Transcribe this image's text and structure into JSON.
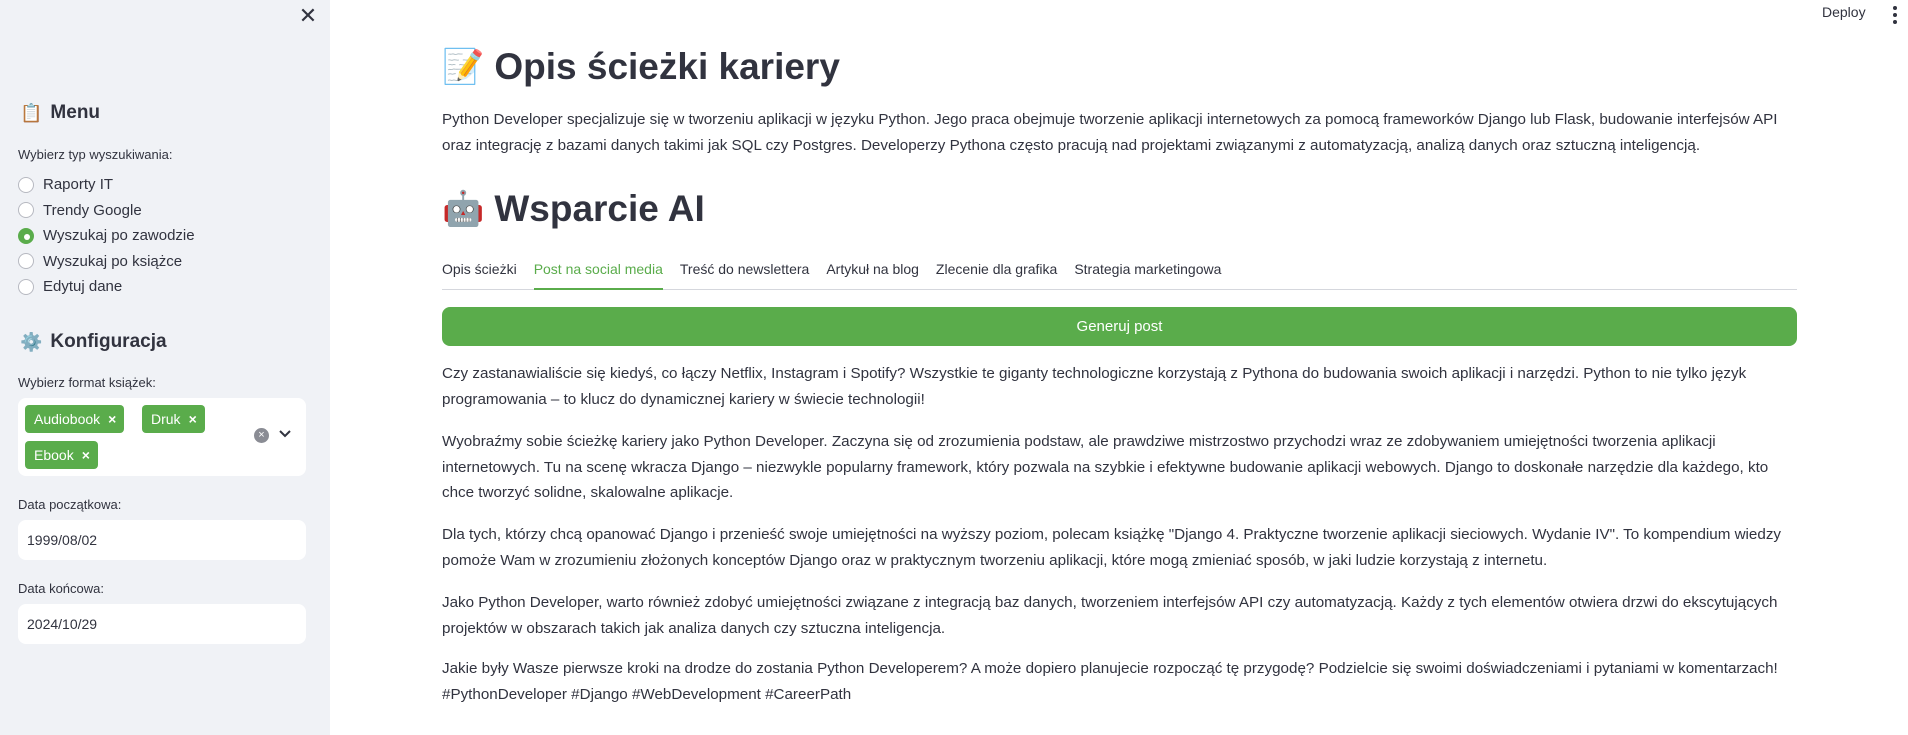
{
  "sidebar": {
    "menu": {
      "icon": "📋",
      "title": "Menu"
    },
    "search_type": {
      "label": "Wybierz typ wyszukiwania:",
      "options": [
        "Raporty IT",
        "Trendy Google",
        "Wyszukaj po zawodzie",
        "Wyszukaj po książce",
        "Edytuj dane"
      ],
      "selected": "Wyszukaj po zawodzie"
    },
    "config": {
      "icon": "⚙️",
      "title": "Konfiguracja"
    },
    "book_format": {
      "label": "Wybierz format książek:",
      "tags": [
        "Audiobook",
        "Druk",
        "Ebook"
      ],
      "tag_remove": "×",
      "clear": "×"
    },
    "start_date": {
      "label": "Data początkowa:",
      "value": "1999/08/02"
    },
    "end_date": {
      "label": "Data końcowa:",
      "value": "2024/10/29"
    },
    "close": "✕"
  },
  "header": {
    "deploy": "Deploy"
  },
  "main": {
    "career": {
      "icon": "📝",
      "title": "Opis ścieżki kariery",
      "text": "Python Developer specjalizuje się w tworzeniu aplikacji w języku Python. Jego praca obejmuje tworzenie aplikacji internetowych za pomocą frameworków Django lub Flask, budowanie interfejsów API oraz integrację z bazami danych takimi jak SQL czy Postgres. Developerzy Pythona często pracują nad projektami związanymi z automatyzacją, analizą danych oraz sztuczną inteligencją."
    },
    "ai": {
      "icon": "🤖",
      "title": "Wsparcie AI"
    },
    "tabs": [
      "Opis ścieżki",
      "Post na social media",
      "Treść do newslettera",
      "Artykuł na blog",
      "Zlecenie dla grafika",
      "Strategia marketingowa"
    ],
    "active_tab": "Post na social media",
    "generate_button": "Generuj post",
    "post": [
      "Czy zastanawialiście się kiedyś, co łączy Netflix, Instagram i Spotify? Wszystkie te giganty technologiczne korzystają z Pythona do budowania swoich aplikacji i narzędzi. Python to nie tylko język programowania – to klucz do dynamicznej kariery w świecie technologii!",
      "Wyobraźmy sobie ścieżkę kariery jako Python Developer. Zaczyna się od zrozumienia podstaw, ale prawdziwe mistrzostwo przychodzi wraz ze zdobywaniem umiejętności tworzenia aplikacji internetowych. Tu na scenę wkracza Django – niezwykle popularny framework, który pozwala na szybkie i efektywne budowanie aplikacji webowych. Django to doskonałe narzędzie dla każdego, kto chce tworzyć solidne, skalowalne aplikacje.",
      "Dla tych, którzy chcą opanować Django i przenieść swoje umiejętności na wyższy poziom, polecam książkę \"Django 4. Praktyczne tworzenie aplikacji sieciowych. Wydanie IV\". To kompendium wiedzy pomoże Wam w zrozumieniu złożonych konceptów Django oraz w praktycznym tworzeniu aplikacji, które mogą zmieniać sposób, w jaki ludzie korzystają z internetu.",
      "Jako Python Developer, warto również zdobyć umiejętności związane z integracją baz danych, tworzeniem interfejsów API czy automatyzacją. Każdy z tych elementów otwiera drzwi do ekscytujących projektów w obszarach takich jak analiza danych czy sztuczna inteligencja.",
      "Jakie były Wasze pierwsze kroki na drodze do zostania Python Developerem? A może dopiero planujecie rozpocząć tę przygodę? Podzielcie się swoimi doświadczeniami i pytaniami w komentarzach! #PythonDeveloper #Django #WebDevelopment #CareerPath"
    ]
  },
  "colors": {
    "accent": "#5aac4b",
    "sidebar_bg": "#f0f2f6",
    "text": "#31333F"
  }
}
